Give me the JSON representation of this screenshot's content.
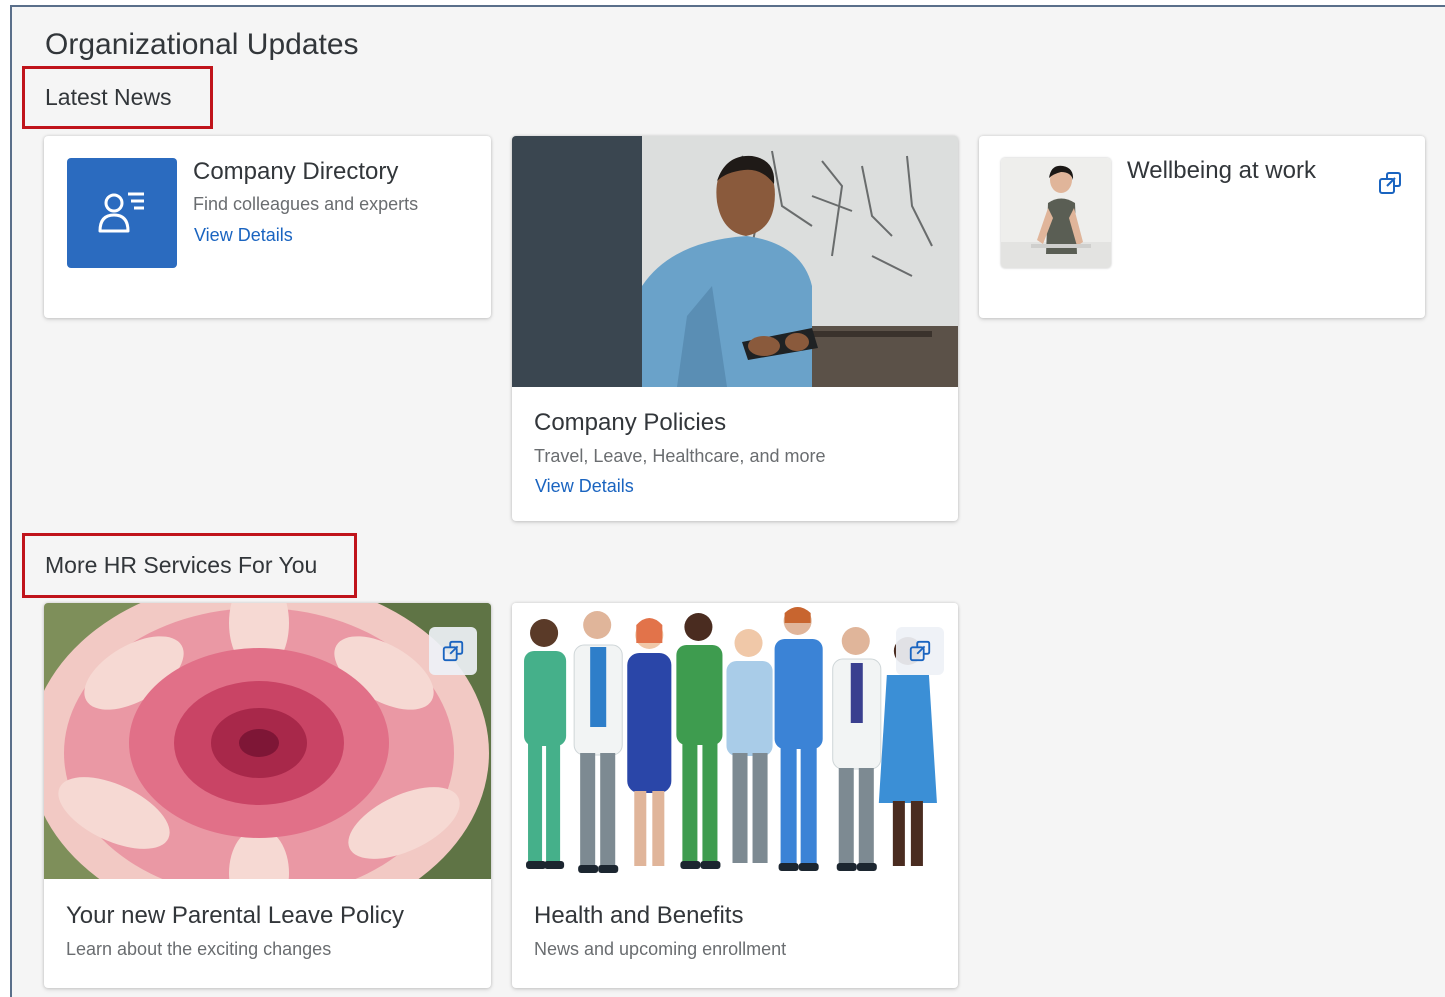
{
  "page": {
    "title": "Organizational Updates"
  },
  "sections": {
    "latest_news": "Latest News",
    "more_hr": "More HR Services For You"
  },
  "cards": {
    "company_directory": {
      "title": "Company Directory",
      "subtitle": "Find colleagues and experts",
      "link": "View Details",
      "icon": "person-list-icon"
    },
    "company_policies": {
      "title": "Company Policies",
      "subtitle": "Travel, Leave, Healthcare, and more",
      "link": "View Details",
      "image": "man-with-tablet-photo"
    },
    "wellbeing": {
      "title": "Wellbeing at work",
      "image": "woman-at-desk-photo",
      "icon": "external-link-icon"
    },
    "parental_leave": {
      "title": "Your new Parental Leave Policy",
      "subtitle": "Learn about the exciting changes",
      "image": "pink-dahlia-photo",
      "icon": "external-link-icon"
    },
    "health_benefits": {
      "title": "Health and Benefits",
      "subtitle": "News and upcoming enrollment",
      "image": "healthcare-workers-illustration",
      "icon": "external-link-icon"
    }
  },
  "colors": {
    "accent_blue": "#2b6bbf",
    "link_blue": "#1a64c0",
    "highlight_red": "#c0141b",
    "background": "#f5f5f5"
  }
}
